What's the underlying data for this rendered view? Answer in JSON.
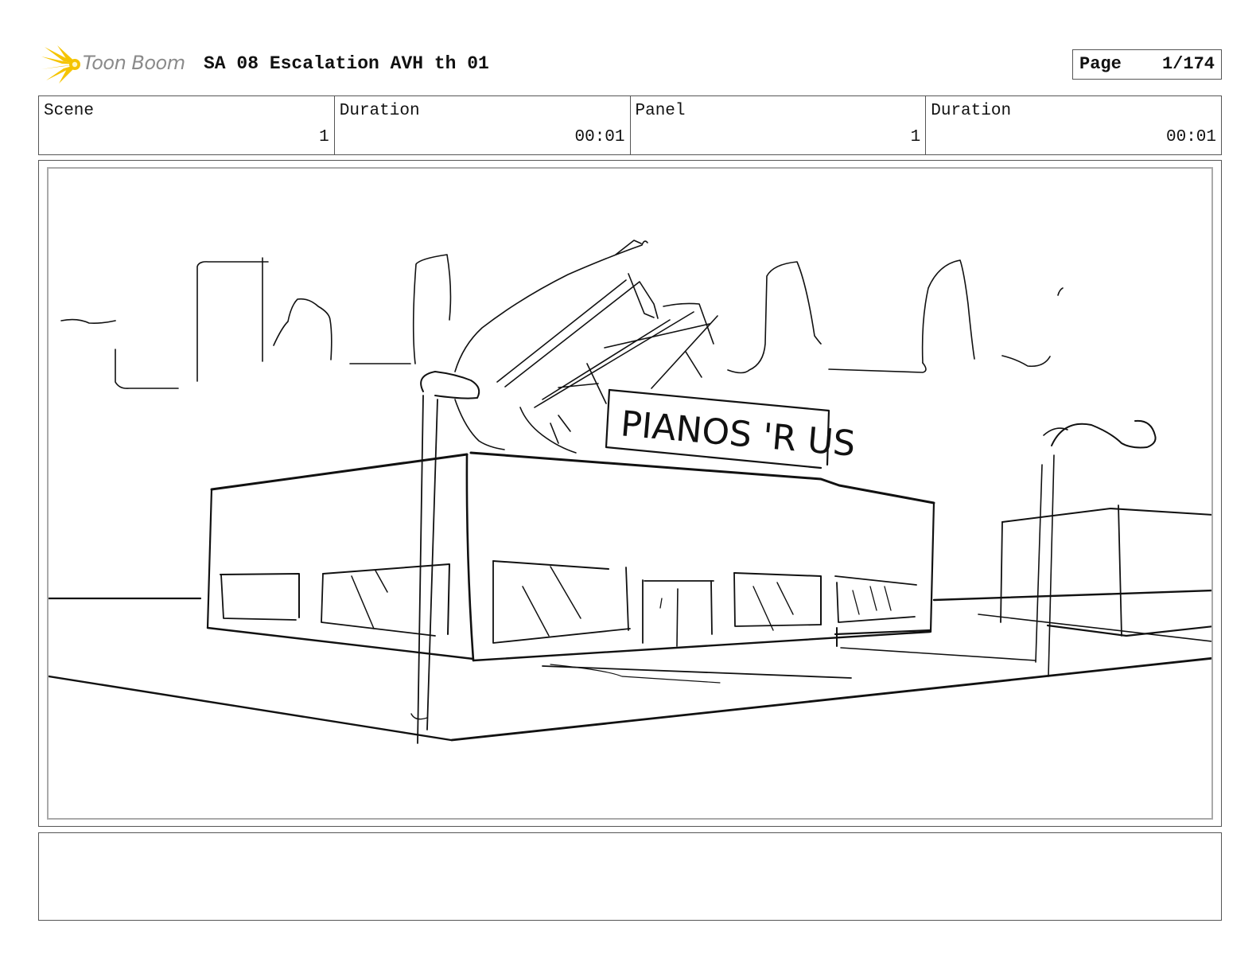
{
  "header": {
    "logo_text": "Toon Boom",
    "title": "SA 08 Escalation AVH th 01"
  },
  "page": {
    "label": "Page",
    "value": "1/174"
  },
  "info": {
    "scene": {
      "label": "Scene",
      "value": "1"
    },
    "scene_duration": {
      "label": "Duration",
      "value": "00:01"
    },
    "panel": {
      "label": "Panel",
      "value": "1"
    },
    "panel_duration": {
      "label": "Duration",
      "value": "00:01"
    }
  },
  "sketch": {
    "sign_text": "PIANOS 'R US"
  },
  "notes": {
    "text": ""
  },
  "colors": {
    "logo_yellow": "#f5c400",
    "logo_text": "#8a8a8a",
    "ink": "#111111"
  }
}
